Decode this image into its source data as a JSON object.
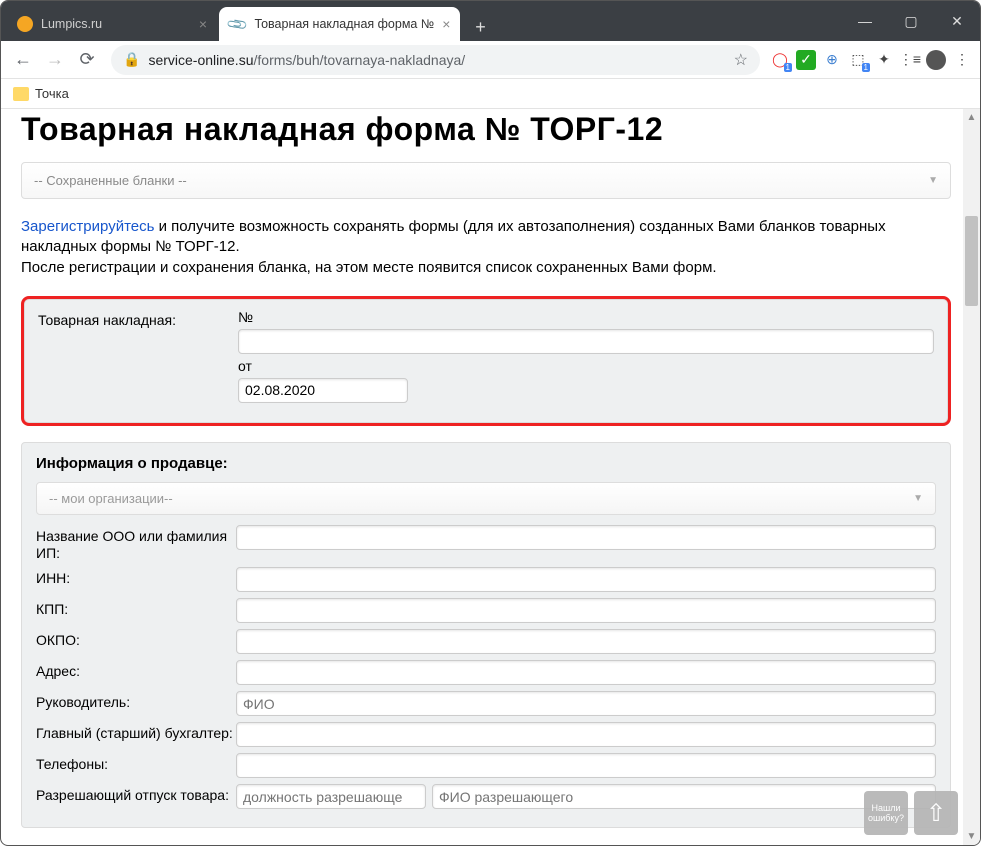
{
  "browser": {
    "tabs": [
      {
        "title": "Lumpics.ru"
      },
      {
        "title": "Товарная накладная форма №"
      }
    ],
    "url_host": "service-online.su",
    "url_path": "/forms/buh/tovarnaya-nakladnaya/",
    "bookmark": "Точка"
  },
  "page": {
    "heading": "Товарная накладная форма № ТОРГ-12",
    "saved_dropdown": "-- Сохраненные бланки --",
    "notice_link": "Зарегистрируйтесь",
    "notice_text1": " и получите возможность сохранять формы (для их автозаполнения) созданных Вами бланков товарных накладных формы № ТОРГ-12.",
    "notice_text2": "После регистрации и сохранения бланка, на этом месте появится список сохраненных Вами форм.",
    "nakladnaya": {
      "label": "Товарная накладная:",
      "number_label": "№",
      "number_value": "",
      "date_label": "от",
      "date_value": "02.08.2020"
    },
    "seller": {
      "title": "Информация о продавце:",
      "orgs_dropdown": "-- мои организации--",
      "fields": {
        "name_label": "Название ООО или фамилия ИП:",
        "inn_label": "ИНН:",
        "kpp_label": "КПП:",
        "okpo_label": "ОКПО:",
        "address_label": "Адрес:",
        "director_label": "Руководитель:",
        "director_placeholder": "ФИО",
        "accountant_label": "Главный (старший) бухгалтер:",
        "phones_label": "Телефоны:",
        "permit_label": "Разрешающий отпуск товара:",
        "permit_pos_placeholder": "должность разрешающе",
        "permit_fio_placeholder": "ФИО разрешающего"
      }
    },
    "float_feedback": "Нашли ошибку?"
  }
}
